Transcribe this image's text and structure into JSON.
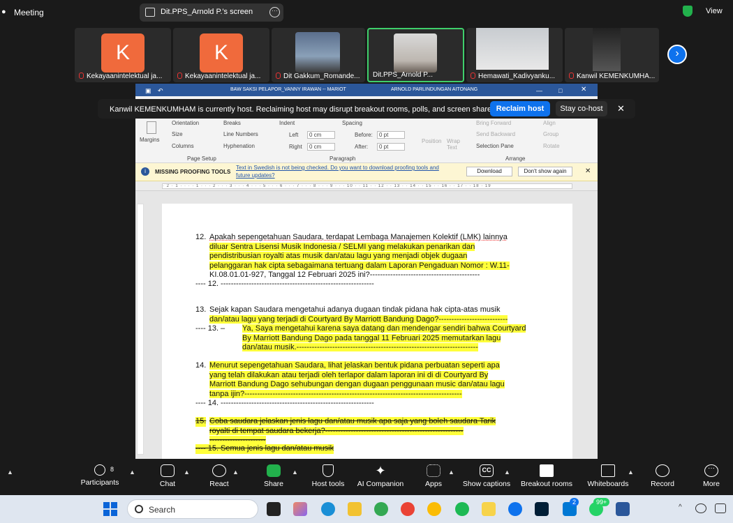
{
  "topbar": {
    "title": "Meeting",
    "screen_label": "Dit.PPS_Arnold P.'s screen",
    "view": "View"
  },
  "participants": [
    {
      "name": "Kekayaanintelektual ja...",
      "initial": "K"
    },
    {
      "name": "Kekayaanintelektual ja...",
      "initial": "K"
    },
    {
      "name": "Dit Gakkum_Romande..."
    },
    {
      "name": "Dit.PPS_Arnold P..."
    },
    {
      "name": "Hemawati_Kadivyanku..."
    },
    {
      "name": "Kanwil KEMENKUMHA..."
    }
  ],
  "banner": {
    "text": "Kanwil KEMENKUMHAM is currently host. Reclaiming host may disrupt breakout rooms, polls, and screen share",
    "reclaim": "Reclaim host",
    "cohost": "Stay co-host",
    "close": "✕"
  },
  "word": {
    "title_left": "BAW SAKSI PELAPOR_VANNY IRAWAN -- MARIOT",
    "title_right": "ARNOLD PARLINDUNGAN AITONANG",
    "ribbon": {
      "margins": "Margins",
      "orientation": "Orientation",
      "size": "Size",
      "columns": "Columns",
      "breaks": "Breaks",
      "line_numbers": "Line Numbers",
      "hyphenation": "Hyphenation",
      "page_setup": "Page Setup",
      "indent": "Indent",
      "spacing": "Spacing",
      "left": "Left",
      "right": "Right",
      "before": "Before:",
      "after": "After:",
      "left_val": "0 cm",
      "right_val": "0 cm",
      "before_val": "0 pt",
      "after_val": "0 pt",
      "paragraph": "Paragraph",
      "position": "Position",
      "wrap_text": "Wrap Text",
      "bring_forward": "Bring Forward",
      "send_backward": "Send Backward",
      "selection_pane": "Selection Pane",
      "align": "Align",
      "group": "Group",
      "rotate": "Rotate",
      "arrange": "Arrange"
    },
    "msgbar": {
      "title": "MISSING PROOFING TOOLS",
      "text1": "Text in Swedish is not being checked. Do you want to download proofing tools and",
      "text2": "future updates?",
      "download": "Download",
      "dont_show": "Don't show again"
    },
    "ruler": "· 2 · 1 · · · · 1 · · · 2 · · · 3 · · · 4 · · · 5 · · · 6 · · · 7 · · · 8 · · · 9 · · · 10 · · 11 · · 12 · · 13 · · 14 · · 15 · · 16 · · 17 · · 18 · 19"
  },
  "doc": {
    "q12_num": "12.",
    "q12_l1": "Apakah sepengetahuan Saudara, terdapat Lembaga Manajemen Kolektif (LMK) lainnya",
    "q12_l2": "diluar Sentra Lisensi Musik Indonesia / SELMI yang melakukan penarikan dan",
    "q12_l3": "pendistribusian royalti atas musik dan/atau lagu yang menjadi objek dugaan",
    "q12_l4": "pelanggaran hak cipta sebagaimana tertuang dalam Laporan Pengaduan Nomor : W.11-",
    "q12_l5": "KI.08.01.01-927, Tanggal 12 Februari 2025 ini?-------------------------------------------",
    "a12": "---- 12. ------------------------------------------------------------",
    "q13_num": "13.",
    "q13_l1": "Sejak kapan Saudara mengetahui adanya dugaan tindak pidana hak cipta-atas musik",
    "q13_l2": "dan/atau lagu yang terjadi di Courtyard By Marriott Bandung Dago?---------------------------",
    "a13_pre": "---- 13. –",
    "a13_l1": "Ya, Saya mengetahui karena saya datang dan mendengar sendiri bahwa Courtyard",
    "a13_l2": "By Marriott Bandung Dago pada tanggal 11 Februari 2025 memutarkan lagu",
    "a13_l3": "dan/atau musik.-----------------------------------------------------------------------",
    "q14_num": "14.",
    "q14_l1": "Menurut sepengetahuan Saudara, lihat jelaskan bentuk pidana perbuatan seperti apa",
    "q14_l2": "yang telah dilakukan atau terjadi oleh terlapor dalam laporan ini di di Courtyard By",
    "q14_l3": "Marriott Bandung Dago sehubungan dengan dugaan penggunaan music dan/atau lagu",
    "q14_l4": "tanpa ijin?-------------------------------------------------------------------------------------",
    "a14": "---- 14. ------------------------------------------------------------",
    "q15_num": "15.",
    "q15_l1": "Coba saudara jelaskan jenis lagu dan/atau musik apa saja yang boleh saudara Tarik",
    "q15_l2": "royalti di tempat saudara bekerja?------------------------------------------------------",
    "q15_l3": "----------------------",
    "a15": "---- 15. Semua jenis lagu dan/atau musik"
  },
  "toolbar": {
    "participants": "Participants",
    "participants_count": "8",
    "chat": "Chat",
    "react": "React",
    "share": "Share",
    "host_tools": "Host tools",
    "ai_companion": "AI Companion",
    "apps": "Apps",
    "show_captions": "Show captions",
    "breakout_rooms": "Breakout rooms",
    "whiteboards": "Whiteboards",
    "record": "Record",
    "more": "More"
  },
  "taskbar": {
    "search": "Search",
    "badge1": "2",
    "badge2": "99+"
  },
  "colors": {
    "accent": "#0e72ed",
    "highlight": "#ffff3a",
    "word_blue": "#2b579a",
    "selected_tile": "#3fd06b"
  }
}
